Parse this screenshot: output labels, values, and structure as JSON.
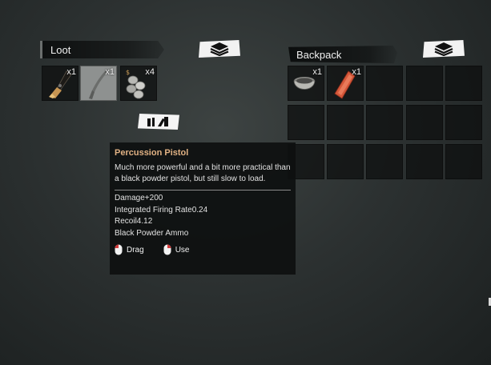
{
  "loot": {
    "title": "Loot",
    "items": [
      {
        "name": "black-powder-pistol",
        "qty": "x1",
        "selected": false
      },
      {
        "name": "percussion-pistol",
        "qty": "x1",
        "selected": true
      },
      {
        "name": "coins",
        "qty": "x4",
        "selected": false
      }
    ]
  },
  "backpack": {
    "title": "Backpack",
    "items": [
      {
        "name": "mortar-bowl",
        "qty": "x1"
      },
      {
        "name": "red-ration-bar",
        "qty": "x1"
      }
    ]
  },
  "tooltip": {
    "name": "Percussion Pistol",
    "description": "Much more powerful and a bit more practical than a black powder pistol, but still slow to load.",
    "stats": [
      "Damage+200",
      "Integrated Firing Rate0.24",
      "Recoil4.12",
      "Black Powder Ammo"
    ],
    "actions": [
      {
        "label": "Drag",
        "icon": "left-mouse-icon"
      },
      {
        "label": "Use",
        "icon": "right-mouse-icon"
      }
    ]
  },
  "colors": {
    "item_name": "#e0b183",
    "selected_slot": "#8e9190",
    "slot_bg": "#0c0e0e"
  }
}
